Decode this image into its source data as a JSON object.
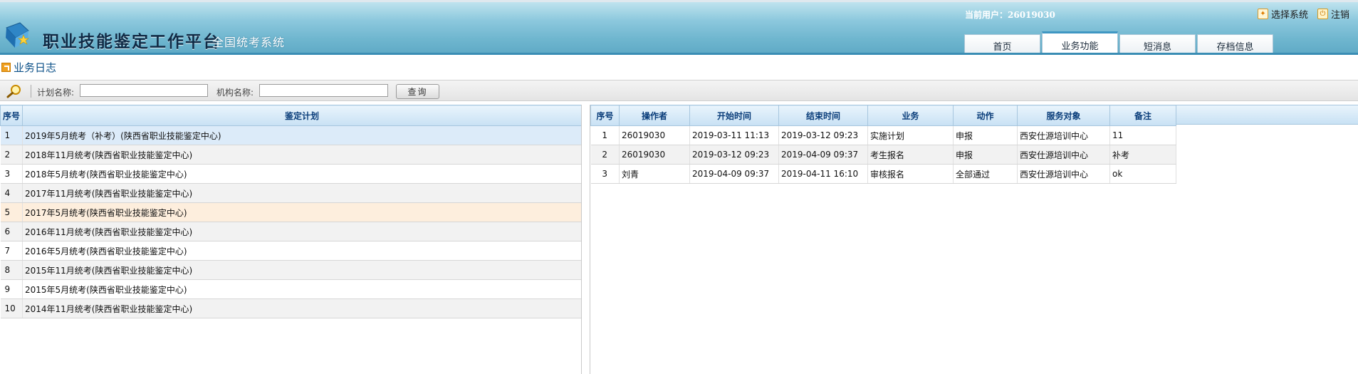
{
  "header": {
    "app_title": "职业技能鉴定工作平台",
    "app_subtitle": "全国统考系统",
    "current_user": "当前用户：26019030",
    "select_system": "选择系统",
    "logout": "注销"
  },
  "nav": {
    "tabs": [
      {
        "label": "首页",
        "active": false
      },
      {
        "label": "业务功能",
        "active": true
      },
      {
        "label": "短消息",
        "active": false
      },
      {
        "label": "存档信息",
        "active": false
      }
    ]
  },
  "page": {
    "title": "业务日志"
  },
  "search": {
    "plan_label": "计划名称:",
    "plan_value": "",
    "org_label": "机构名称:",
    "org_value": "",
    "query_button": "查询"
  },
  "plan_table": {
    "headers": [
      "序号",
      "鉴定计划"
    ],
    "rows": [
      [
        "1",
        "2019年5月统考（补考）(陕西省职业技能鉴定中心)"
      ],
      [
        "2",
        "2018年11月统考(陕西省职业技能鉴定中心)"
      ],
      [
        "3",
        "2018年5月统考(陕西省职业技能鉴定中心)"
      ],
      [
        "4",
        "2017年11月统考(陕西省职业技能鉴定中心)"
      ],
      [
        "5",
        "2017年5月统考(陕西省职业技能鉴定中心)"
      ],
      [
        "6",
        "2016年11月统考(陕西省职业技能鉴定中心)"
      ],
      [
        "7",
        "2016年5月统考(陕西省职业技能鉴定中心)"
      ],
      [
        "8",
        "2015年11月统考(陕西省职业技能鉴定中心)"
      ],
      [
        "9",
        "2015年5月统考(陕西省职业技能鉴定中心)"
      ],
      [
        "10",
        "2014年11月统考(陕西省职业技能鉴定中心)"
      ]
    ]
  },
  "log_table": {
    "headers": [
      "序号",
      "操作者",
      "开始时间",
      "结束时间",
      "业务",
      "动作",
      "服务对象",
      "备注"
    ],
    "rows": [
      [
        "1",
        "26019030",
        "2019-03-11 11:13",
        "2019-03-12 09:23",
        "实施计划",
        "申报",
        "西安仕源培训中心",
        "11"
      ],
      [
        "2",
        "26019030",
        "2019-03-12 09:23",
        "2019-04-09 09:37",
        "考生报名",
        "申报",
        "西安仕源培训中心",
        "补考"
      ],
      [
        "3",
        "刘青",
        "2019-04-09 09:37",
        "2019-04-11 16:10",
        "审核报名",
        "全部通过",
        "西安仕源培训中心",
        "ok"
      ]
    ]
  },
  "colors": {
    "header_blue": "#6fb6cf",
    "grid_header_text": "#0a3d7a",
    "title_text": "#0a4f87",
    "selected_row": "#dcebf9",
    "highlight_row": "#fdeedd"
  }
}
